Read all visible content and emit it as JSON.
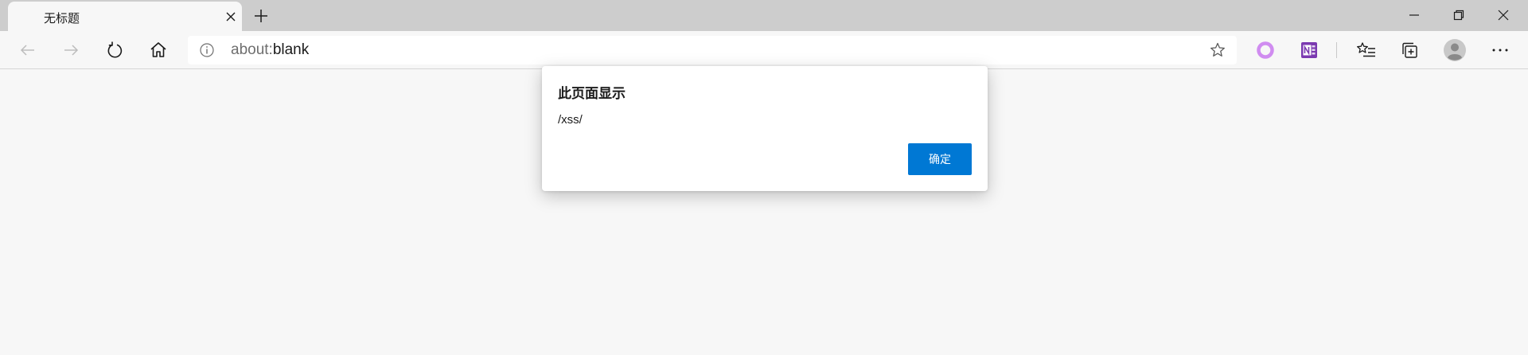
{
  "browser": {
    "tab": {
      "title": "无标题"
    },
    "address_bar": {
      "scheme_text": "about:",
      "path_text": "blank"
    },
    "icons": {
      "back": "arrow-left-icon",
      "forward": "arrow-right-icon",
      "refresh": "refresh-icon",
      "home": "home-icon",
      "info": "info-icon",
      "favorite": "star-icon",
      "extension_1": "circle-extension-icon",
      "extension_2": "onenote-icon",
      "favorites": "favorites-list-icon",
      "collections": "collections-icon",
      "profile": "avatar-icon",
      "more": "more-icon"
    },
    "colors": {
      "tabstrip": "#cdcdcd",
      "toolbar": "#f7f7f7",
      "extension_1": "#d08cf0",
      "extension_2": "#7b3ab0"
    }
  },
  "dialog": {
    "title": "此页面显示",
    "message": "/xss/",
    "ok_label": "确定",
    "accent": "#0078d4"
  }
}
